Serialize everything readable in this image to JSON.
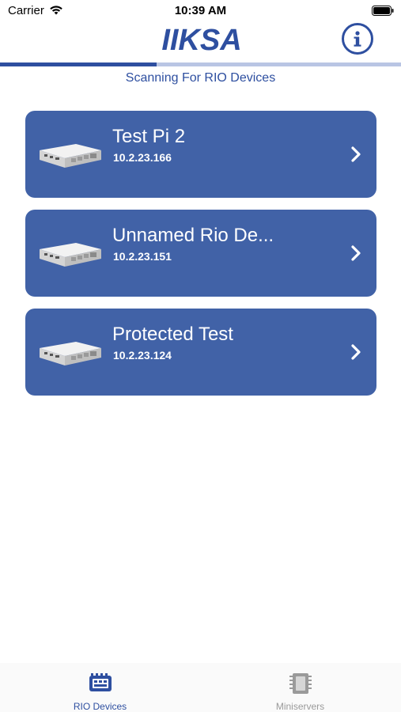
{
  "status_bar": {
    "carrier": "Carrier",
    "time": "10:39 AM"
  },
  "header": {
    "logo_text": "IIKSA",
    "info_icon": "info-icon"
  },
  "scan": {
    "title": "Scanning For RIO Devices",
    "progress": 0.39
  },
  "devices": [
    {
      "name": "Test Pi 2",
      "ip": "10.2.23.166"
    },
    {
      "name": "Unnamed Rio De...",
      "ip": "10.2.23.151"
    },
    {
      "name": "Protected Test",
      "ip": "10.2.23.124"
    }
  ],
  "tabs": [
    {
      "label": "RIO Devices",
      "icon": "rio-device-icon",
      "active": true
    },
    {
      "label": "Miniservers",
      "icon": "chip-icon",
      "active": false
    }
  ],
  "colors": {
    "accent": "#2e4fa0",
    "card": "#4162a7",
    "inactive": "#9a9a9a"
  }
}
